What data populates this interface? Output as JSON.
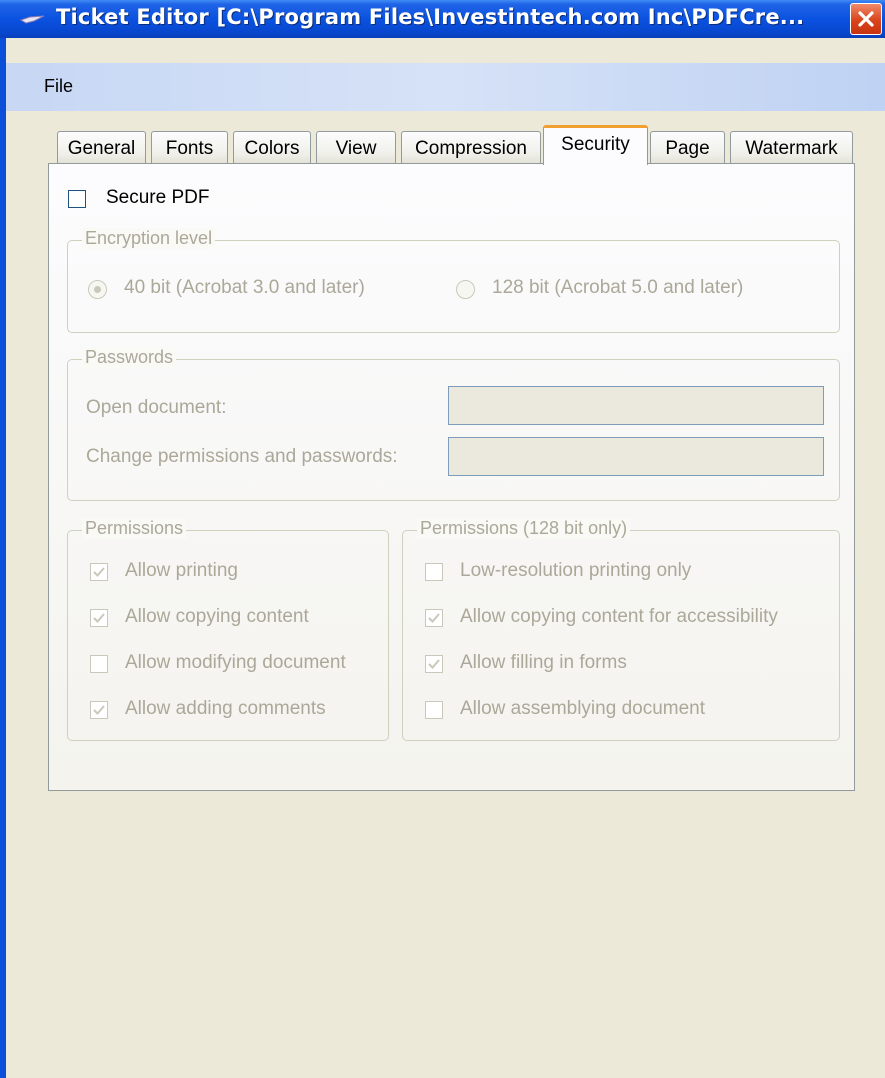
{
  "window": {
    "title": "Ticket Editor [C:\\Program Files\\Investintech.com Inc\\PDFCre...",
    "close_label": "close"
  },
  "menu": {
    "file": "File"
  },
  "tabs": [
    {
      "label": "General"
    },
    {
      "label": "Fonts"
    },
    {
      "label": "Colors"
    },
    {
      "label": "View"
    },
    {
      "label": "Compression"
    },
    {
      "label": "Security",
      "active": true
    },
    {
      "label": "Page"
    },
    {
      "label": "Watermark"
    }
  ],
  "security": {
    "secure_pdf": {
      "label": "Secure PDF",
      "checked": false,
      "enabled": true
    },
    "encryption": {
      "legend": "Encryption level",
      "option_40": {
        "label": "40 bit (Acrobat 3.0 and later)",
        "selected": true
      },
      "option_128": {
        "label": "128 bit (Acrobat 5.0 and later)",
        "selected": false
      }
    },
    "passwords": {
      "legend": "Passwords",
      "open_label": "Open document:",
      "open_value": "",
      "change_label": "Change permissions and passwords:",
      "change_value": ""
    },
    "permissions": {
      "legend": "Permissions",
      "items": [
        {
          "label": "Allow printing",
          "checked": true
        },
        {
          "label": "Allow copying content",
          "checked": true
        },
        {
          "label": "Allow modifying document",
          "checked": false
        },
        {
          "label": "Allow adding comments",
          "checked": true
        }
      ]
    },
    "permissions_128": {
      "legend": "Permissions (128 bit only)",
      "items": [
        {
          "label": "Low-resolution printing only",
          "checked": false
        },
        {
          "label": "Allow copying content for accessibility",
          "checked": true
        },
        {
          "label": "Allow filling in forms",
          "checked": true
        },
        {
          "label": "Allow assemblying document",
          "checked": false
        }
      ]
    }
  },
  "colors": {
    "titlebar": "#0a52e0",
    "active_tab_highlight": "#f0a030",
    "disabled_text": "#aca899",
    "window_bg": "#ece9d8"
  }
}
